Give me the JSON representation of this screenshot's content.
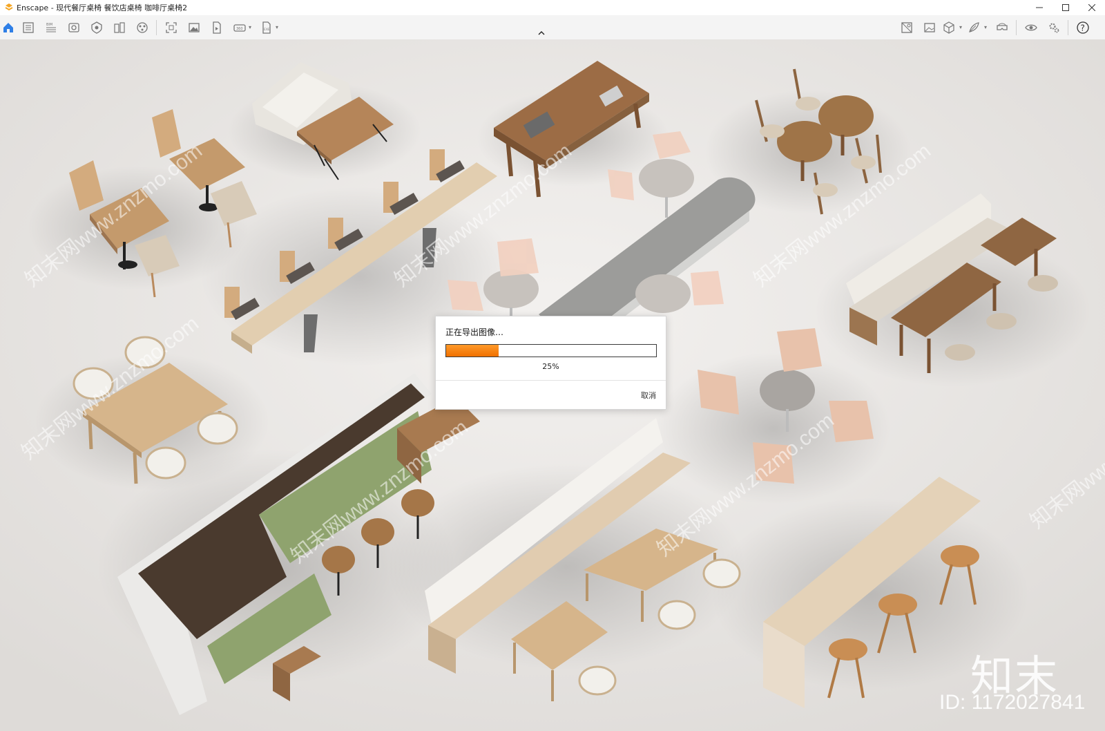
{
  "window": {
    "title": "Enscape - 现代餐厅桌椅 餐饮店桌椅 咖啡厅桌椅2",
    "controls": [
      "minimize",
      "maximize",
      "close"
    ]
  },
  "toolbar": {
    "left_icons": [
      "home-icon",
      "view-management-icon",
      "bim-icon",
      "visual-settings-icon",
      "safe-frame-icon",
      "clip-planes-icon",
      "asset-library-icon",
      "screenshot-icon",
      "batch-render-icon",
      "video-export-icon",
      "panorama-icon",
      "exe-export-icon"
    ],
    "right_icons": [
      "capture-icon",
      "image-icon",
      "cube-icon",
      "feather-icon",
      "vr-headset-icon",
      "eye-icon",
      "settings-icon",
      "help-icon"
    ]
  },
  "dialog": {
    "title": "正在导出图像…",
    "progress": 0.25,
    "percent_label": "25%",
    "cancel_label": "取消"
  },
  "watermark": {
    "logo": "知末",
    "id_text": "ID: 1172027841",
    "diagonal_text": "知末网www.znzmo.com"
  },
  "colors": {
    "progress_fill": "#f07a10",
    "accent_blue": "#2f7fe6",
    "floor": "#ebe9e7",
    "wood_light": "#d9bf9a",
    "wood_dark": "#8f6642",
    "bench_green": "#8fa36e"
  }
}
